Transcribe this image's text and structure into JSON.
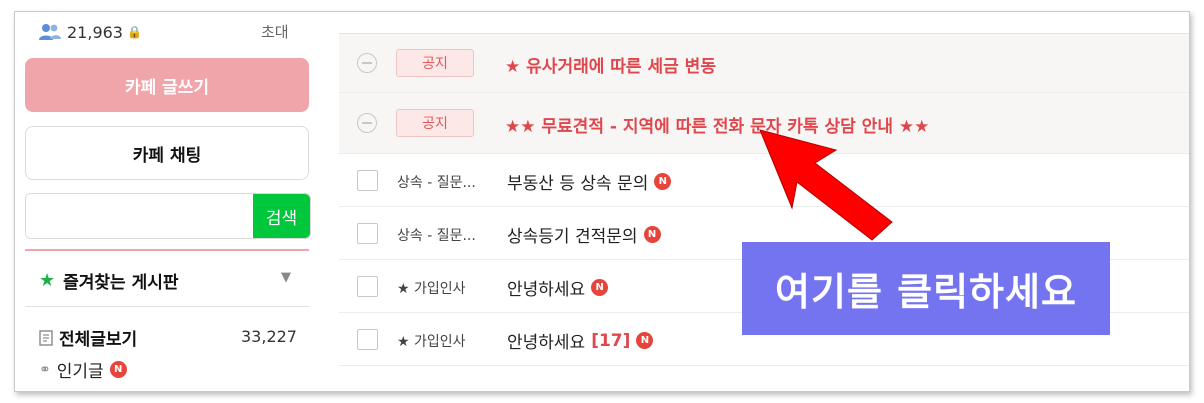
{
  "sidebar": {
    "member_count": "21,963",
    "invite_label": "초대",
    "write_button": "카페 글쓰기",
    "chat_button": "카페 채팅",
    "search": {
      "value": "",
      "button": "검색"
    },
    "favorites_label": "즐겨찾는 게시판",
    "all_posts_label": "전체글보기",
    "all_posts_count": "33,227",
    "popular_label": "인기글",
    "new_badge": "N"
  },
  "notices": [
    {
      "badge": "공지",
      "title": "★ 유사거래에 따른 세금 변동"
    },
    {
      "badge": "공지",
      "title": "★★ 무료견적 - 지역에 따른 전화 문자 카톡 상담 안내 ★★"
    }
  ],
  "posts": [
    {
      "category": "상속 - 질문...",
      "title": "부동산 등 상속 문의",
      "comments": "",
      "badge": "N"
    },
    {
      "category": "상속 - 질문...",
      "title": "상속등기 견적문의",
      "comments": "",
      "badge": "N"
    },
    {
      "category": "★ 가입인사",
      "title": "안녕하세요",
      "comments": "",
      "badge": "N"
    },
    {
      "category": "★ 가입인사",
      "title": "안녕하세요",
      "comments": "[17]",
      "badge": "N"
    }
  ],
  "overlay": {
    "callout_text": "여기를 클릭하세요",
    "arrow_color": "#ff0000",
    "callout_color": "#7474f0"
  },
  "colors": {
    "accent_pink": "#efa5aa",
    "search_green": "#00c73c",
    "notice_red": "#e0474c"
  }
}
